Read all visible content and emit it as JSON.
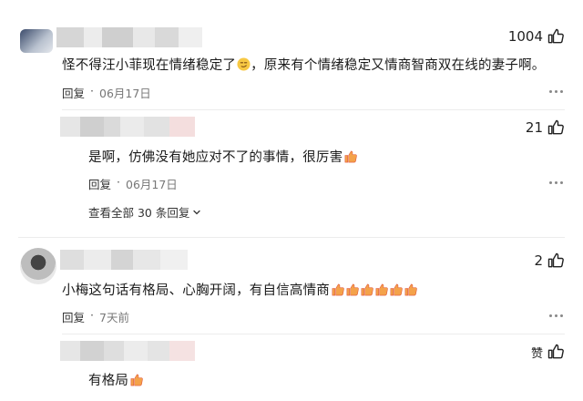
{
  "comments": [
    {
      "likes": "1004",
      "text": "怪不得汪小菲现在情绪稳定了",
      "text_tail": "，原来有个情绪稳定又情商智商双在线的妻子啊。",
      "reply_label": "回复",
      "date": "06月17日"
    },
    {
      "likes": "21",
      "text": "是啊，仿佛没有她应对不了的事情，很厉害",
      "reply_label": "回复",
      "date": "06月17日",
      "view_all": "查看全部 30 条回复"
    },
    {
      "likes": "2",
      "text": "小梅这句话有格局、心胸开阔，有自信高情商",
      "reply_label": "回复",
      "date": "7天前"
    },
    {
      "likes": "赞",
      "text": "有格局"
    }
  ],
  "icons": {
    "like": "thumbs-up-icon",
    "more": "more-dots-icon",
    "emoji_smile": "smirk-emoji",
    "emoji_thumb": "thumbs-up-emoji",
    "chevron": "chevron-down-icon"
  }
}
